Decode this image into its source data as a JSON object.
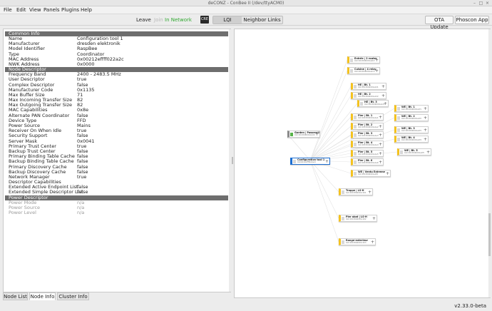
{
  "window": {
    "title": "deCONZ - ConBee II (/dev/ttyACM0)"
  },
  "menu": [
    "File",
    "Edit",
    "View",
    "Panels",
    "Plugins",
    "Help"
  ],
  "toolbar": {
    "leave": "Leave",
    "join": "Join",
    "network_status": "In Network",
    "cre": "CRE",
    "lqi": "LQI",
    "neighbor_links": "Neighbor Links",
    "ota_update": "OTA Update",
    "phoscon_app": "Phoscon App"
  },
  "node_info": [
    {
      "section": "Common Info",
      "rows": [
        [
          "Name",
          "Configuration tool 1"
        ],
        [
          "Manufacturer",
          "dresden elektronik"
        ],
        [
          "Model Identifier",
          "RaspBee"
        ],
        [
          "Type",
          "Coordinator"
        ],
        [
          "MAC Address",
          "0x00212effff022a2c"
        ],
        [
          "NWK Address",
          "0x0000"
        ]
      ]
    },
    {
      "section": "Node Descriptor",
      "rows": [
        [
          "Frequency Band",
          "2400 - 2483.5 MHz"
        ],
        [
          "User Descriptor",
          "true"
        ],
        [
          "Complex Descriptor",
          "false"
        ],
        [
          "Manufacturer Code",
          "0x1135"
        ],
        [
          "Max Buffer Size",
          "71"
        ],
        [
          "Max Incoming Transfer Size",
          "82"
        ],
        [
          "Max Outgoing Transfer Size",
          "82"
        ],
        [
          "MAC Capabilities",
          "0x8e"
        ],
        [
          "Alternate PAN Coordinator",
          "false"
        ],
        [
          "Device Type",
          "FFD"
        ],
        [
          "Power Source",
          "Mains"
        ],
        [
          "Receiver On When Idle",
          "true"
        ],
        [
          "Security Support",
          "false"
        ],
        [
          "Server Mask",
          "0x0041"
        ],
        [
          "Primary Trust Center",
          "true"
        ],
        [
          "Backup Trust Center",
          "false"
        ],
        [
          "Primary Binding Table Cache",
          "false"
        ],
        [
          "Backup Binding Table Cache",
          "false"
        ],
        [
          "Primary Discovery Cache",
          "false"
        ],
        [
          "Backup Discovery Cache",
          "false"
        ],
        [
          "Network Manager",
          "true"
        ],
        [
          "Descriptor Capabilities",
          ""
        ],
        [
          "Extended Active Endpoint List",
          "false"
        ],
        [
          "Extended Simple Descriptor List",
          "false"
        ]
      ]
    },
    {
      "section": "Power Descriptor",
      "dim": true,
      "rows": [
        [
          "Power Mode",
          "n/a"
        ],
        [
          "Power Source",
          "n/a"
        ],
        [
          "Power Level",
          "n/a"
        ]
      ]
    }
  ],
  "tabs": [
    "Node List",
    "Node Info",
    "Cluster Info"
  ],
  "active_tab": "Node Info",
  "nodes": [
    {
      "id": "n1",
      "title": "Entrée | 2 router",
      "sub": "0x0 00158d0001a2b3",
      "color": "yellow"
    },
    {
      "id": "n2",
      "title": "Cuisine | 4 relay",
      "sub": "0x0 00158d0001a2c4",
      "color": "yellow"
    },
    {
      "id": "n3",
      "title": "HE | Bt. 1",
      "sub": "0x0 00158d0001a1d1",
      "color": "yellow"
    },
    {
      "id": "n4",
      "title": "HE | Bt. 2",
      "sub": "0x0 00158d0001a1d2",
      "color": "yellow"
    },
    {
      "id": "n5",
      "title": "HE | Bt. 3",
      "sub": "0x0 00158d0001a1d3",
      "color": "yellow"
    },
    {
      "id": "n6",
      "title": "Pler | Bt. 1",
      "sub": "0x0 00158d0001a1e1",
      "color": "yellow"
    },
    {
      "id": "n7",
      "title": "Pler | Bt. 2",
      "sub": "0x0 00158d0001a1e2",
      "color": "yellow"
    },
    {
      "id": "n8",
      "title": "Pler | Bt. 3",
      "sub": "0x0 00158d0001a1e3",
      "color": "yellow"
    },
    {
      "id": "n9",
      "title": "Pler | Bt. 4",
      "sub": "0x0 00158d0001a1e4",
      "color": "yellow"
    },
    {
      "id": "n10",
      "title": "Pler | Bt. 5",
      "sub": "0x0 00158d0001a1e5",
      "color": "yellow"
    },
    {
      "id": "n11",
      "title": "Pler | Bt. 6",
      "sub": "0x0 00158d0001a1e6",
      "color": "yellow"
    },
    {
      "id": "n12",
      "title": "WE | Bt. 1",
      "sub": "0x0 00158d0001a1f1",
      "color": "yellow"
    },
    {
      "id": "n13",
      "title": "WE | Bt. 2",
      "sub": "0x0 00158d0001a1f2",
      "color": "yellow"
    },
    {
      "id": "n14",
      "title": "WE | Bt. 3",
      "sub": "0x0 00158d0001a1f3",
      "color": "yellow"
    },
    {
      "id": "n15",
      "title": "WE | Bt. 4",
      "sub": "0x0 00158d0001a1f4",
      "color": "yellow"
    },
    {
      "id": "n16",
      "title": "WE | Bt. 5",
      "sub": "0x0 00158d0001a1f5",
      "color": "yellow"
    },
    {
      "id": "n17",
      "title": "WE | Ventu Extreme",
      "sub": "0x0 00158d0001a1f6",
      "color": "yellow"
    },
    {
      "id": "n18",
      "title": "Garden | Passerelle",
      "sub": "0x0 00158d0001b100",
      "color": "green"
    },
    {
      "id": "n19",
      "title": "Configuration tool 1",
      "sub": "0x00212effff022a2c",
      "color": "blue"
    },
    {
      "id": "n20",
      "title": "Trappe | LS-H",
      "sub": "0x0 00158d0001c201",
      "color": "yellow"
    },
    {
      "id": "n21",
      "title": "Pler abat | LS-H",
      "sub": "0x0 00158d0001c202",
      "color": "yellow"
    },
    {
      "id": "n22",
      "title": "Range-exterieur",
      "sub": "0x0 00158d0001c203",
      "color": "yellow"
    }
  ],
  "status": {
    "version": "v2.33.0-beta"
  }
}
